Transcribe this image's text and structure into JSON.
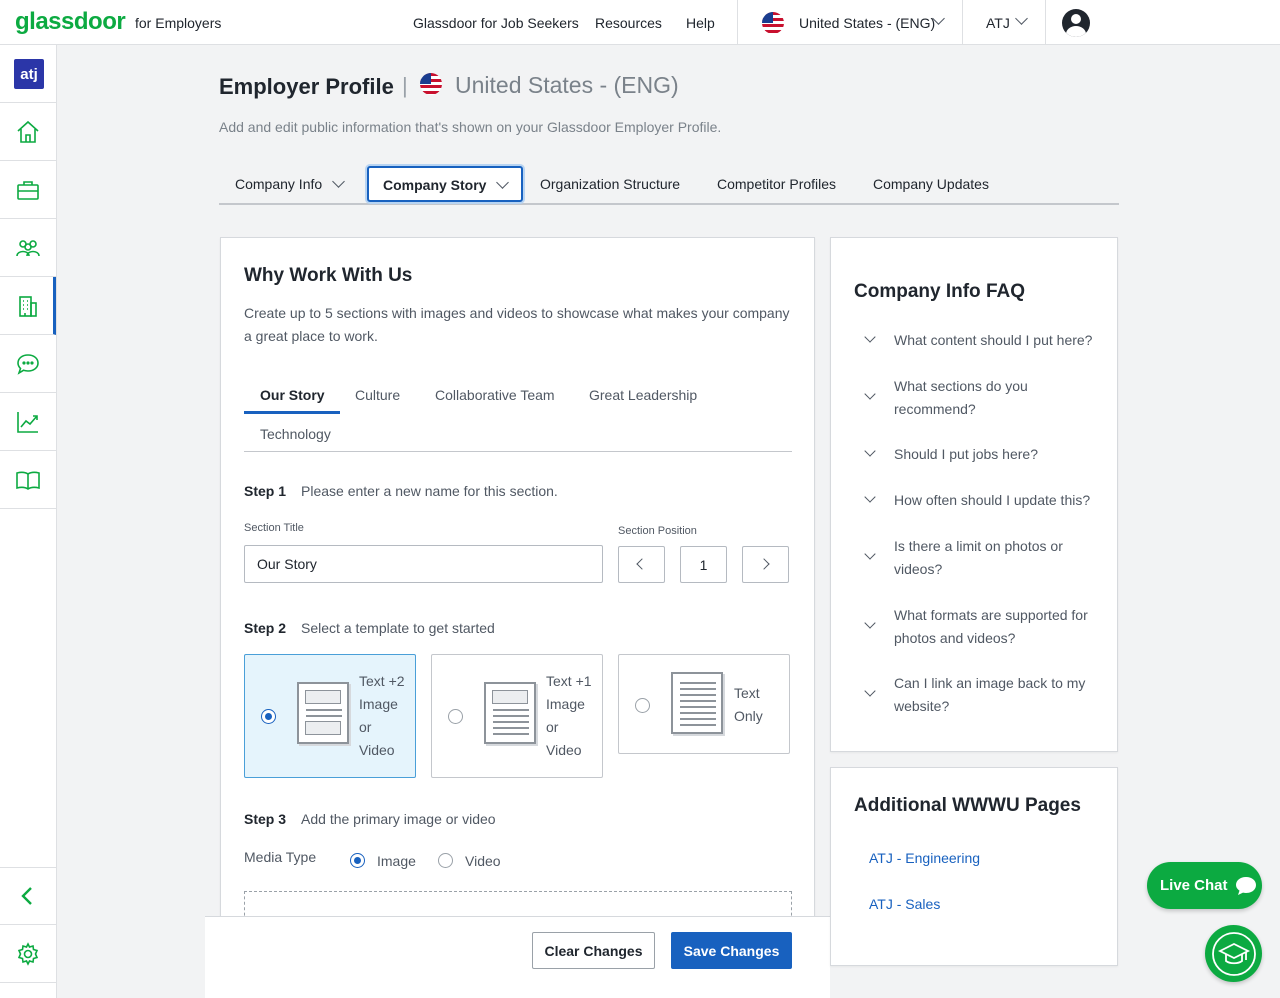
{
  "header": {
    "logo": "glassdoor",
    "logo_sub": "for Employers",
    "nav": [
      "Glassdoor for Job Seekers",
      "Resources",
      "Help"
    ],
    "locale": "United States - (ENG)",
    "account": "ATJ"
  },
  "sidebar": {
    "logo_text": "atj",
    "items": [
      "home-icon",
      "briefcase-icon",
      "people-icon",
      "building-icon",
      "chat-icon",
      "analytics-icon",
      "book-icon"
    ],
    "active": "building-icon",
    "bottom": [
      "collapse-icon",
      "gear-icon"
    ]
  },
  "page": {
    "title": "Employer Profile",
    "separator": "|",
    "country": "United States - (ENG)",
    "description": "Add and edit public information that's shown on your Glassdoor Employer Profile."
  },
  "tabs": {
    "company_info": "Company Info",
    "company_story": "Company Story",
    "org_structure": "Organization Structure",
    "competitor_profiles": "Competitor Profiles",
    "company_updates": "Company Updates",
    "active": "Company Story"
  },
  "wwwu": {
    "title": "Why Work With Us",
    "desc_line1": "Create up to 5 sections with images and videos to showcase what makes your company",
    "desc_line2": "a great place to work.",
    "subtabs": {
      "our_story": "Our Story",
      "culture": "Culture",
      "collab_team": "Collaborative Team",
      "great_leadership": "Great Leadership",
      "technology": "Technology",
      "active": "Our Story"
    },
    "step1": {
      "label": "Step 1",
      "text": "Please enter a new name for this section."
    },
    "section_title_label": "Section Title",
    "section_title_value": "Our Story",
    "section_position_label": "Section Position",
    "section_position_value": "1",
    "step2": {
      "label": "Step 2",
      "text": "Select a template to get started"
    },
    "templates": {
      "t1": {
        "line1": "Text +2",
        "line2": "Image",
        "line3": "or",
        "line4": "Video",
        "selected": true
      },
      "t2": {
        "line1": "Text +1",
        "line2": "Image",
        "line3": "or",
        "line4": "Video",
        "selected": false
      },
      "t3": {
        "line1": "Text",
        "line2": "Only",
        "selected": false
      }
    },
    "step3": {
      "label": "Step 3",
      "text": "Add the primary image or video"
    },
    "media_type_label": "Media Type",
    "media_image": "Image",
    "media_video": "Video",
    "media_selected": "Image"
  },
  "faq": {
    "title": "Company Info FAQ",
    "q1": "What content should I put here?",
    "q2a": "What sections do you",
    "q2b": "recommend?",
    "q3": "Should I put jobs here?",
    "q4": "How often should I update this?",
    "q5a": "Is there a limit on photos or",
    "q5b": "videos?",
    "q6a": "What formats are supported for",
    "q6b": "photos and videos?",
    "q7a": "Can I link an image back to my",
    "q7b": "website?"
  },
  "additional": {
    "title": "Additional WWWU Pages",
    "links": [
      "ATJ - Engineering",
      "ATJ - Sales"
    ]
  },
  "actions": {
    "clear": "Clear Changes",
    "save": "Save Changes"
  },
  "live_chat": "Live Chat",
  "colors": {
    "brand_green": "#0caa41",
    "primary_blue": "#1861bf",
    "selected_bg": "#e5f4fc"
  }
}
